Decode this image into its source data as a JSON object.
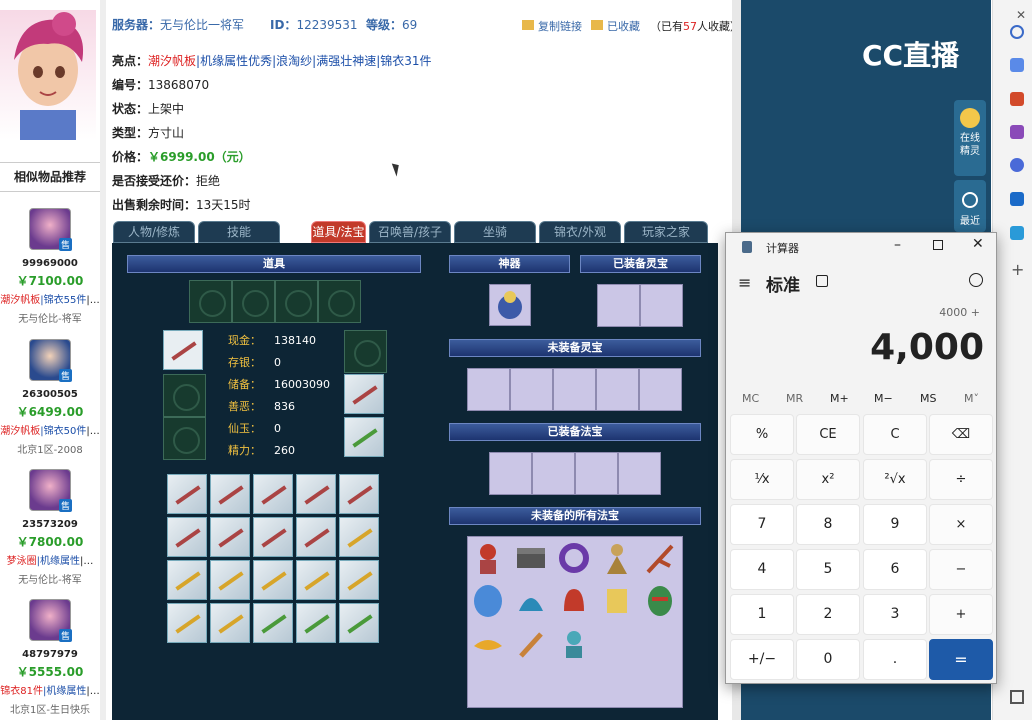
{
  "header": {
    "server_label": "服务器：",
    "server_value": "无与伦比一将军",
    "id_label": "ID：",
    "id_value": "12239531",
    "level_label": "等级：",
    "level_value": "69",
    "copy_link": "复制链接",
    "collected": "已收藏",
    "collect_count_prefix": "（已有",
    "collect_count": "57",
    "collect_count_suffix": "人收藏）"
  },
  "info": {
    "highlight_label": "亮点：",
    "highlight_tags": [
      "潮汐帆板",
      "机缘属性优秀",
      "浪淘纱",
      "满强壮神速",
      "锦衣31件"
    ],
    "number_label": "编号：",
    "number_value": "13868070",
    "status_label": "状态：",
    "status_value": "上架中",
    "type_label": "类型：",
    "type_value": "方寸山",
    "price_label": "价格：",
    "price_value": "￥6999.00（元）",
    "bargain_label": "是否接受还价：",
    "bargain_value": "拒绝",
    "remaining_label": "出售剩余时间：",
    "remaining_value": "13天15时"
  },
  "tabs": [
    "人物/修炼",
    "技能",
    "道具/法宝",
    "召唤兽/孩子",
    "坐骑",
    "锦衣/外观",
    "玩家之家"
  ],
  "active_tab": 2,
  "panel": {
    "items_bar": "道具",
    "artifact_bar": "神器",
    "equipped_spirit_bar": "已装备灵宝",
    "unequipped_spirit_bar": "未装备灵宝",
    "equipped_magic_bar": "已装备法宝",
    "unequipped_magic_bar": "未装备的所有法宝",
    "stats": [
      {
        "label": "现金：",
        "value": "138140"
      },
      {
        "label": "存银：",
        "value": "0"
      },
      {
        "label": "储备：",
        "value": "16003090"
      },
      {
        "label": "善恶：",
        "value": "836"
      },
      {
        "label": "仙玉：",
        "value": "0"
      },
      {
        "label": "精力：",
        "value": "260"
      }
    ]
  },
  "sidebar": {
    "title": "相似物品推荐",
    "items": [
      {
        "id": "99969000",
        "price": "￥7100.00",
        "tag1": "潮汐帆板",
        "tag2": "锦衣55件",
        "tag3": "|…",
        "server": "无与伦比-将军"
      },
      {
        "id": "26300505",
        "price": "￥6499.00",
        "tag1": "潮汐帆板",
        "tag2": "锦衣50件",
        "tag3": "|…",
        "server": "北京1区-2008"
      },
      {
        "id": "23573209",
        "price": "￥7800.00",
        "tag1": "梦泳圈",
        "tag2": "机缘属性",
        "tag3": "|…",
        "server": "无与伦比-将军"
      },
      {
        "id": "48797979",
        "price": "￥5555.00",
        "tag1": "锦衣81件",
        "tag2": "机缘属性",
        "tag3": "|…",
        "server": "北京1区-生日快乐"
      }
    ],
    "badge": "售"
  },
  "right": {
    "logo": "CC直播",
    "spirit_label": "在线精灵",
    "recent_label": "最近"
  },
  "calculator": {
    "title": "计算器",
    "mode": "标准",
    "expression": "4000 +",
    "display": "4,000",
    "memory": [
      "MC",
      "MR",
      "M+",
      "M−",
      "MS",
      "M˅"
    ],
    "buttons": [
      "%",
      "CE",
      "C",
      "⌫",
      "⅟x",
      "x²",
      "²√x",
      "÷",
      "7",
      "8",
      "9",
      "×",
      "4",
      "5",
      "6",
      "−",
      "1",
      "2",
      "3",
      "+",
      "+/−",
      "0",
      ".",
      "="
    ]
  },
  "colors": {
    "accent": "#1e5aa8",
    "price_green": "#2a9d2a",
    "tag_red": "#d22",
    "panel_bg": "#0d2535"
  }
}
